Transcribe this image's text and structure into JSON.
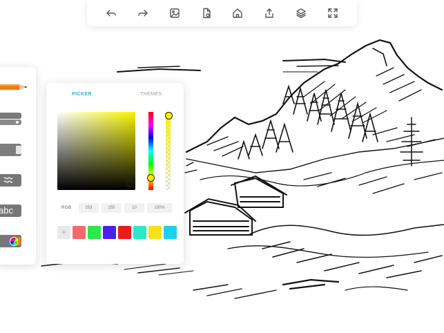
{
  "picker": {
    "tabs": [
      {
        "label": "PICKER",
        "active": true
      },
      {
        "label": "THEMES",
        "active": false
      }
    ],
    "mode_label": "RGB",
    "fields": [
      "253",
      "255",
      "10",
      "100%"
    ],
    "current_hue_color": "#f5f000",
    "swatches": [
      "#f26a6a",
      "#2de84a",
      "#4a1ff0",
      "#ef1b1b",
      "#2de8c8",
      "#f5e21a",
      "#1fcff0"
    ],
    "add_swatch_label": "+"
  },
  "tools_panel": {
    "text_tool_label": "abc",
    "pencil_color": "#f07e12"
  },
  "toolbar": {
    "icons": [
      "undo-icon",
      "redo-icon",
      "image-icon",
      "export-file-icon",
      "home-icon",
      "share-icon",
      "layers-icon",
      "fullscreen-icon"
    ]
  }
}
